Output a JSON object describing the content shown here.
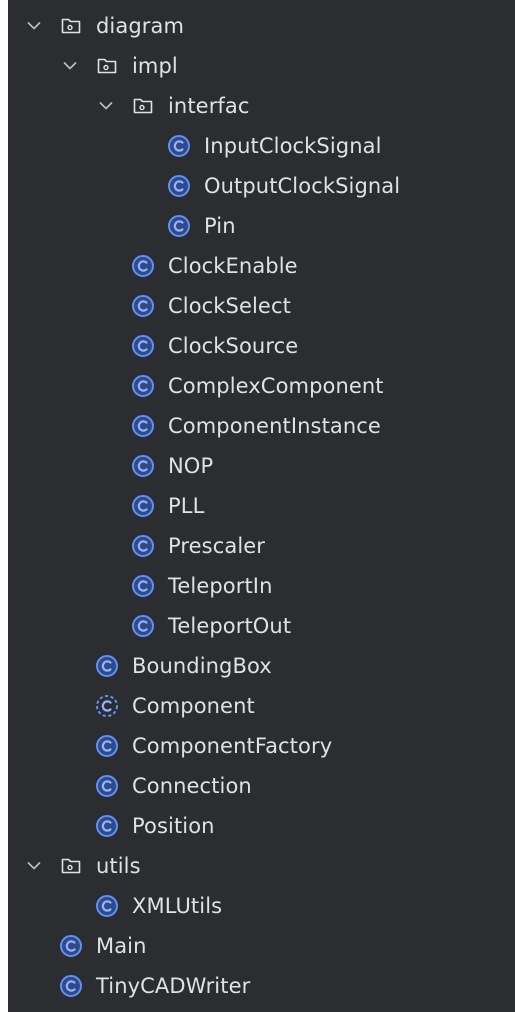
{
  "colors": {
    "panel_bg": "#2b2d30",
    "text": "#dfe1e5",
    "chevron": "#b4b8bf",
    "folder_icon": "#dfe1e5",
    "class_icon_fill": "#2f4a86",
    "class_icon_stroke": "#5f8ff7",
    "class_icon_letter": "#8fb2ff"
  },
  "tree": {
    "diagram": {
      "label": "diagram",
      "icon": "folder-icon",
      "expanded": true,
      "impl": {
        "label": "impl",
        "icon": "folder-icon",
        "expanded": true,
        "interfac": {
          "label": "interfac",
          "icon": "folder-icon",
          "expanded": true,
          "items": [
            {
              "label": "InputClockSignal",
              "icon": "class-icon"
            },
            {
              "label": "OutputClockSignal",
              "icon": "class-icon"
            },
            {
              "label": "Pin",
              "icon": "class-icon"
            }
          ]
        },
        "items": [
          {
            "label": "ClockEnable",
            "icon": "class-icon"
          },
          {
            "label": "ClockSelect",
            "icon": "class-icon"
          },
          {
            "label": "ClockSource",
            "icon": "class-icon"
          },
          {
            "label": "ComplexComponent",
            "icon": "class-icon"
          },
          {
            "label": "ComponentInstance",
            "icon": "class-icon"
          },
          {
            "label": "NOP",
            "icon": "class-icon"
          },
          {
            "label": "PLL",
            "icon": "class-icon"
          },
          {
            "label": "Prescaler",
            "icon": "class-icon"
          },
          {
            "label": "TeleportIn",
            "icon": "class-icon"
          },
          {
            "label": "TeleportOut",
            "icon": "class-icon"
          }
        ]
      },
      "items": [
        {
          "label": "BoundingBox",
          "icon": "class-icon"
        },
        {
          "label": "Component",
          "icon": "abstract-class-icon"
        },
        {
          "label": "ComponentFactory",
          "icon": "class-icon"
        },
        {
          "label": "Connection",
          "icon": "class-icon"
        },
        {
          "label": "Position",
          "icon": "class-icon"
        }
      ]
    },
    "utils": {
      "label": "utils",
      "icon": "folder-icon",
      "expanded": true,
      "items": [
        {
          "label": "XMLUtils",
          "icon": "class-icon"
        }
      ]
    },
    "root_items": [
      {
        "label": "Main",
        "icon": "class-icon"
      },
      {
        "label": "TinyCADWriter",
        "icon": "class-icon"
      }
    ]
  }
}
